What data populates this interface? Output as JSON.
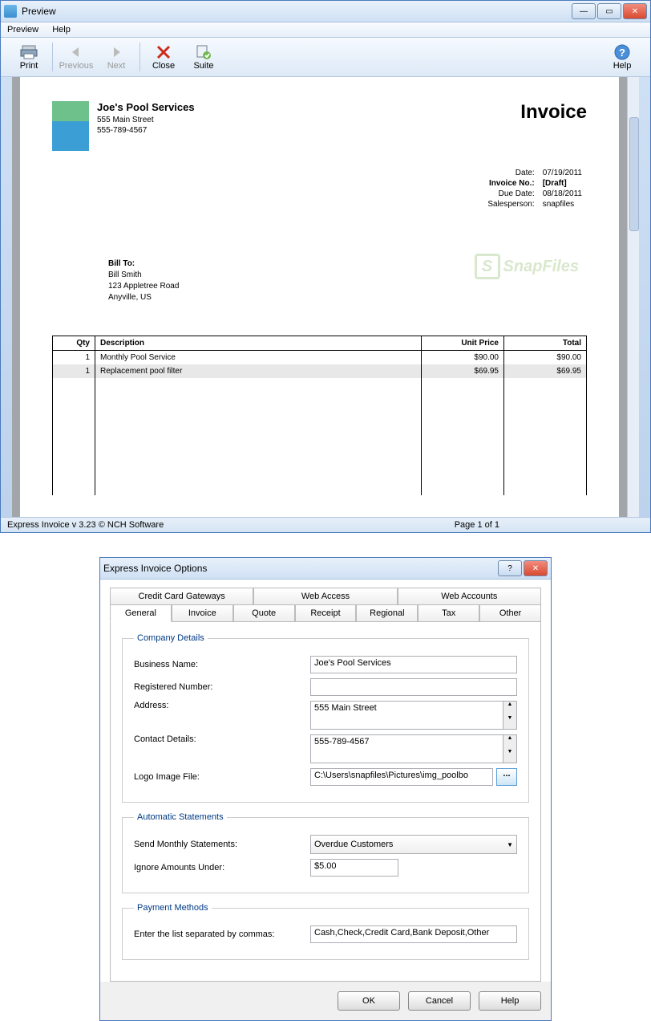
{
  "preview_window": {
    "title": "Preview",
    "menu": {
      "preview": "Preview",
      "help": "Help"
    },
    "toolbar": {
      "print": "Print",
      "previous": "Previous",
      "next": "Next",
      "close": "Close",
      "suite": "Suite",
      "help": "Help"
    },
    "status_left": "Express Invoice v 3.23 © NCH Software",
    "status_right": "Page 1 of 1"
  },
  "invoice": {
    "company_name": "Joe's Pool Services",
    "company_address": "555 Main Street",
    "company_phone": "555-789-4567",
    "doc_title": "Invoice",
    "meta": {
      "date_label": "Date:",
      "date": "07/19/2011",
      "invno_label": "Invoice No.:",
      "invno": "[Draft]",
      "due_label": "Due Date:",
      "due": "08/18/2011",
      "sales_label": "Salesperson:",
      "sales": "snapfiles"
    },
    "billto_label": "Bill To:",
    "billto_name": "Bill Smith",
    "billto_street": "123 Appletree Road",
    "billto_city": "Anyville, US",
    "watermark": "SnapFiles",
    "columns": {
      "qty": "Qty",
      "desc": "Description",
      "price": "Unit Price",
      "total": "Total"
    },
    "items": [
      {
        "qty": "1",
        "desc": "Monthly Pool Service",
        "price": "$90.00",
        "total": "$90.00"
      },
      {
        "qty": "1",
        "desc": "Replacement pool filter",
        "price": "$69.95",
        "total": "$69.95"
      }
    ]
  },
  "options_dialog": {
    "title": "Express Invoice Options",
    "tabs_top": [
      "Credit Card Gateways",
      "Web Access",
      "Web Accounts"
    ],
    "tabs_bottom": [
      "General",
      "Invoice",
      "Quote",
      "Receipt",
      "Regional",
      "Tax",
      "Other"
    ],
    "active_tab": "General",
    "company_details": {
      "legend": "Company Details",
      "business_name_label": "Business Name:",
      "business_name": "Joe's Pool Services",
      "reg_number_label": "Registered Number:",
      "reg_number": "",
      "address_label": "Address:",
      "address": "555 Main Street",
      "contact_label": "Contact Details:",
      "contact": "555-789-4567",
      "logo_label": "Logo Image File:",
      "logo_path": "C:\\Users\\snapfiles\\Pictures\\img_poolbo",
      "browse": "..."
    },
    "auto_statements": {
      "legend": "Automatic Statements",
      "send_label": "Send Monthly Statements:",
      "send_value": "Overdue Customers",
      "ignore_label": "Ignore Amounts Under:",
      "ignore_value": "$5.00"
    },
    "payment_methods": {
      "legend": "Payment Methods",
      "list_label": "Enter the list separated by commas:",
      "list_value": "Cash,Check,Credit Card,Bank Deposit,Other"
    },
    "buttons": {
      "ok": "OK",
      "cancel": "Cancel",
      "help": "Help"
    }
  }
}
